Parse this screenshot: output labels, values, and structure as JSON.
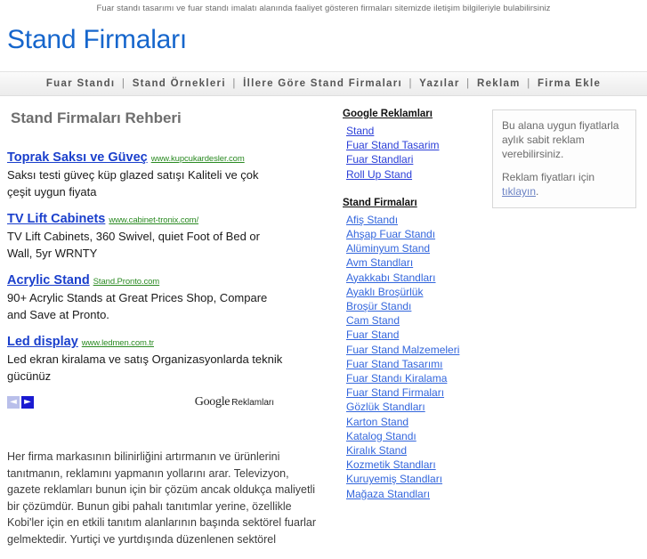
{
  "tagline": "Fuar standı tasarımı ve fuar standı imalatı alanında faaliyet gösteren firmaları sitemizde iletişim bilgileriyle bulabilirsiniz",
  "site_title": "Stand Firmaları",
  "colors": {
    "title_blue": "#1666cc",
    "ad_title_blue": "#1a3fcc",
    "ad_url_green": "#2a8a22",
    "link_blue": "#3366dd",
    "heading_gray": "#6e6e6e",
    "nav_bg": "#f2f2f2"
  },
  "nav": {
    "separator": "|",
    "items": [
      {
        "label": "Fuar Standı"
      },
      {
        "label": "Stand Örnekleri"
      },
      {
        "label": "İllere Göre Stand Firmaları"
      },
      {
        "label": "Yazılar"
      },
      {
        "label": "Reklam"
      },
      {
        "label": "Firma Ekle"
      }
    ]
  },
  "main": {
    "page_heading": "Stand Firmaları Rehberi",
    "ads": [
      {
        "title": "Toprak Saksı ve Güveç",
        "url": "www.kupcukardesler.com",
        "desc": "Saksı testi güveç küp glazed satışı Kaliteli ve çok çeşit uygun fiyata"
      },
      {
        "title": "TV Lift Cabinets",
        "url": "www.cabinet-tronix.com/",
        "desc": "TV Lift Cabinets, 360 Swivel, quiet Foot of Bed or Wall, 5yr WRNTY"
      },
      {
        "title": "Acrylic Stand",
        "url": "Stand.Pronto.com",
        "desc": "90+ Acrylic Stands at Great Prices Shop, Compare and Save at Pronto."
      },
      {
        "title": "Led display",
        "url": "www.ledmen.com.tr",
        "desc": "Led ekran kiralama ve satış Organizasyonlarda teknik gücünüz"
      }
    ],
    "ads_footer": {
      "prev_arrow": "◄",
      "next_arrow": "►",
      "brand_word": "Google",
      "brand_sub": "Reklamları"
    },
    "paragraph": "Her firma markasının bilinirliğini artırmanın ve ürünlerini tanıtmanın, reklamını yapmanın yollarını arar. Televizyon, gazete reklamları bunun için bir çözüm ancak oldukça maliyetli bir çözümdür. Bunun gibi pahalı tanıtımlar yerine, özellikle Kobi'ler için en etkili tanıtım alanlarının başında sektörel fuarlar gelmektedir. Yurtiçi ve yurtdışında düzenlenen sektörel"
  },
  "sidebar": {
    "google_ads": {
      "title": "Google Reklamları",
      "links": [
        {
          "label": "Stand"
        },
        {
          "label": "Fuar Stand Tasarim"
        },
        {
          "label": "Fuar Standlari"
        },
        {
          "label": "Roll Up Stand"
        }
      ]
    },
    "firms": {
      "title": "Stand Firmaları",
      "links": [
        {
          "label": "Afiş Standı"
        },
        {
          "label": "Ahşap Fuar Standı"
        },
        {
          "label": "Alüminyum Stand"
        },
        {
          "label": "Avm Standları"
        },
        {
          "label": "Ayakkabı Standları"
        },
        {
          "label": "Ayaklı Broşürlük"
        },
        {
          "label": "Broşür Standı"
        },
        {
          "label": "Cam Stand"
        },
        {
          "label": "Fuar Stand"
        },
        {
          "label": "Fuar Stand Malzemeleri"
        },
        {
          "label": "Fuar Stand Tasarımı"
        },
        {
          "label": "Fuar Standı Kiralama"
        },
        {
          "label": "Fuar Stand Firmaları"
        },
        {
          "label": "Gözlük Standları"
        },
        {
          "label": "Karton Stand"
        },
        {
          "label": "Katalog Standı"
        },
        {
          "label": "Kiralık Stand"
        },
        {
          "label": "Kozmetik Standları"
        },
        {
          "label": "Kuruyemiş Standları"
        },
        {
          "label": "Mağaza Standları"
        }
      ]
    }
  },
  "promo": {
    "line1": "Bu alana uygun fiyatlarla aylık sabit reklam verebilirsiniz.",
    "line2_prefix": "Reklam fiyatları için ",
    "link": "tıklayın",
    "line2_suffix": "."
  }
}
